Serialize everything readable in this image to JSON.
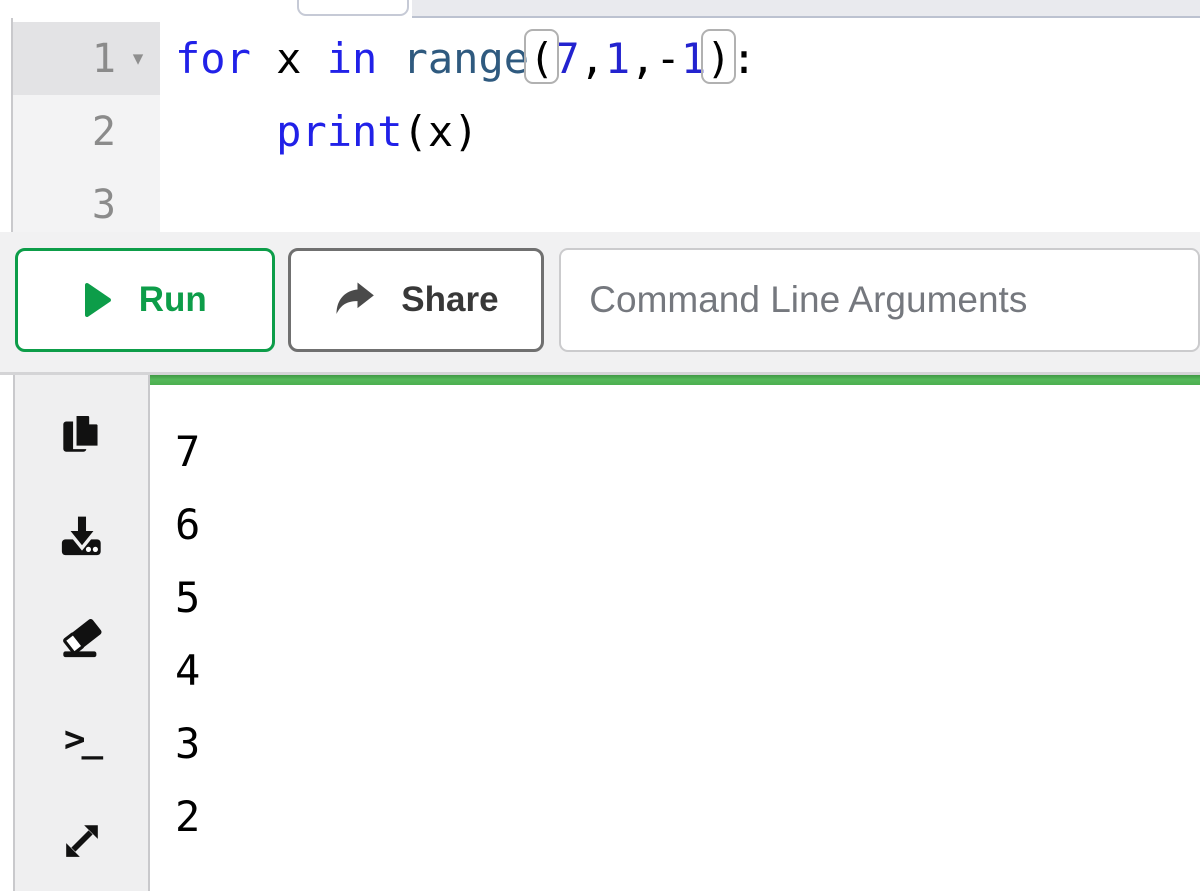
{
  "editor": {
    "lines": [
      {
        "number": "1",
        "active": true,
        "fold": "▾",
        "tokens": [
          [
            "for",
            "kw"
          ],
          [
            " x ",
            "pl"
          ],
          [
            "in",
            "kw"
          ],
          [
            " ",
            "pl"
          ],
          [
            "range",
            "fn"
          ],
          [
            "(",
            "br"
          ],
          [
            "7",
            "num"
          ],
          [
            ",",
            "pl"
          ],
          [
            "1",
            "num"
          ],
          [
            ",",
            "pl"
          ],
          [
            "-",
            "pl"
          ],
          [
            "1",
            "num"
          ],
          [
            ")",
            "br"
          ],
          [
            ":",
            "pl"
          ]
        ]
      },
      {
        "number": "2",
        "active": false,
        "fold": "",
        "tokens": [
          [
            "    ",
            "pl"
          ],
          [
            "print",
            "kw"
          ],
          [
            "(",
            "pl"
          ],
          [
            "x",
            "pl"
          ],
          [
            ")",
            "pl"
          ]
        ]
      },
      {
        "number": "3",
        "active": false,
        "fold": "",
        "tokens": []
      }
    ]
  },
  "toolbar": {
    "run_label": "Run",
    "share_label": "Share",
    "cli_placeholder": "Command Line Arguments",
    "cli_value": ""
  },
  "output": {
    "lines": [
      "7",
      "6",
      "5",
      "4",
      "3",
      "2"
    ]
  },
  "sidebar": {
    "icons": [
      "copy-icon",
      "download-icon",
      "eraser-icon",
      "terminal-icon",
      "expand-icon"
    ],
    "terminal_glyph": ">_"
  },
  "colors": {
    "keyword": "#2121e8",
    "builtin": "#2f5a7f",
    "number": "#2323cf",
    "run_green": "#0d9d49",
    "progress_green": "#4caf50",
    "share_gray": "#4a4a4a",
    "gutter_text": "#8b8b8b",
    "bracket_highlight_border": "#b1b1b1"
  }
}
